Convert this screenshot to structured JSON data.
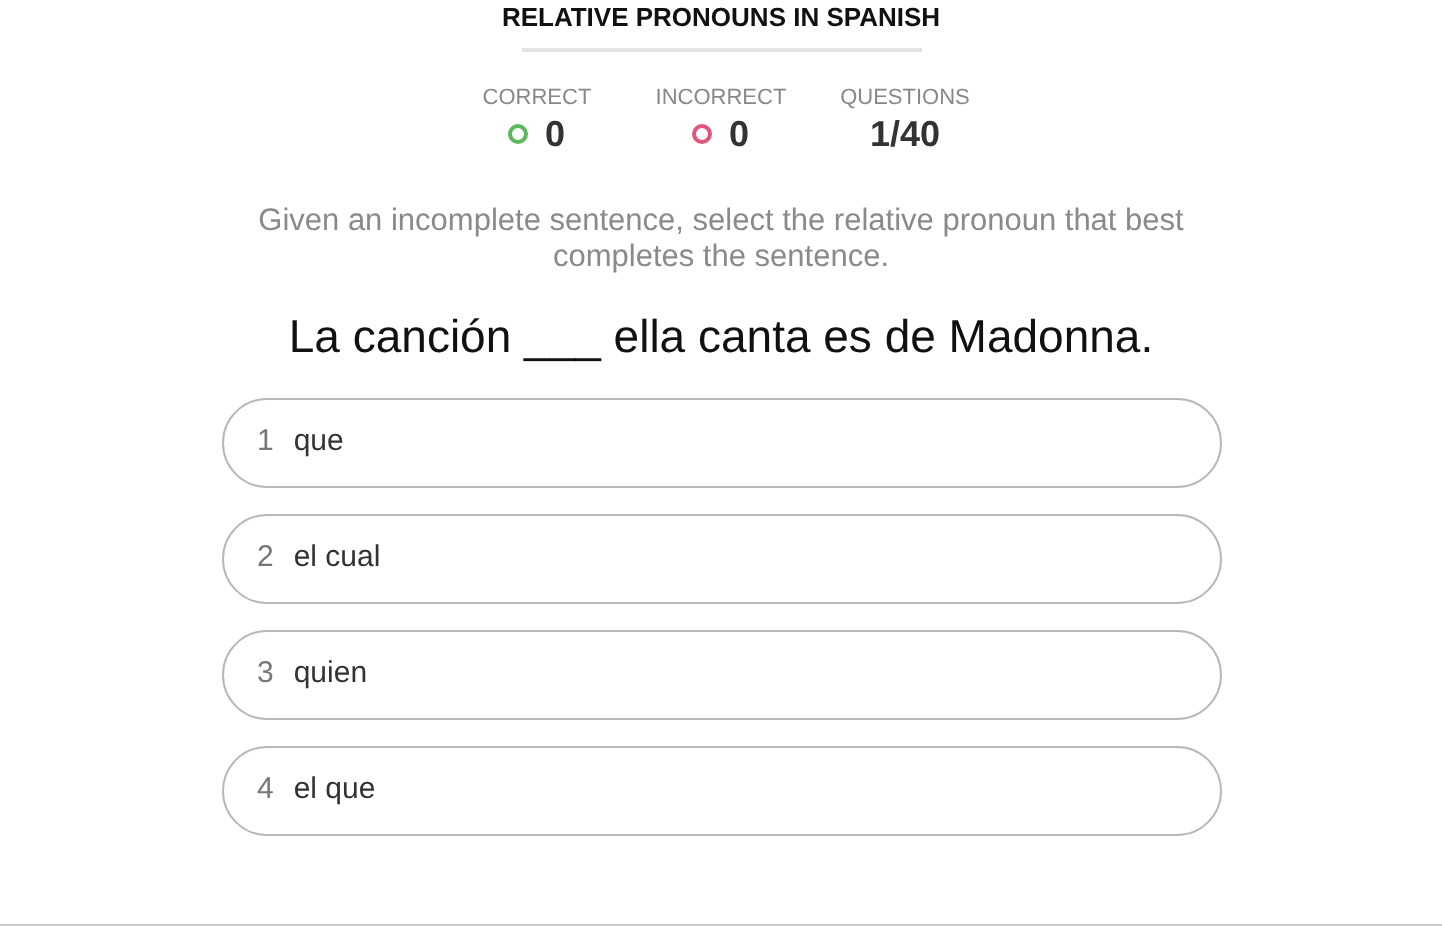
{
  "title": "RELATIVE PRONOUNS IN SPANISH",
  "stats": [
    {
      "label": "CORRECT",
      "value": "0",
      "color": "#5cb85c"
    },
    {
      "label": "INCORRECT",
      "value": "0",
      "color": "#e0557a"
    },
    {
      "label": "QUESTIONS",
      "value": "1/40"
    }
  ],
  "instructions": "Given an incomplete sentence, select the relative pronoun that best completes the sentence.",
  "question": "La canción ___ ella canta es de Madonna.",
  "options": [
    {
      "number": "1",
      "text": "que",
      "selected": false
    },
    {
      "number": "2",
      "text": "el cual",
      "selected": false
    },
    {
      "number": "3",
      "text": "quien",
      "selected": false
    },
    {
      "number": "4",
      "text": "el que",
      "selected": false
    }
  ]
}
